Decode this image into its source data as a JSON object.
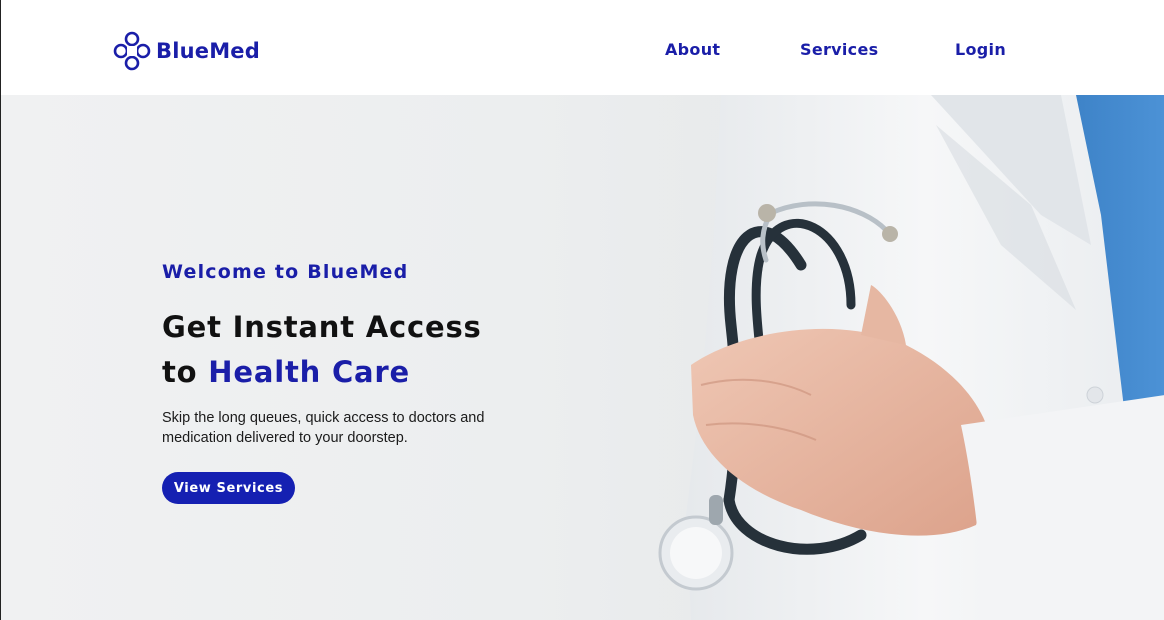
{
  "brand": {
    "name": "BlueMed",
    "color": "#1a1ea8",
    "logo_icon": "medical-cross-rings-icon"
  },
  "nav": {
    "items": [
      {
        "label": "About"
      },
      {
        "label": "Services"
      },
      {
        "label": "Login"
      }
    ]
  },
  "hero": {
    "eyebrow": "Welcome to BlueMed",
    "headline_line1": "Get Instant Access",
    "headline_line2_prefix": "to ",
    "headline_line2_accent": "Health Care",
    "description": "Skip the long queues, quick access to doctors and medication delivered to your doorstep.",
    "cta_label": "View Services",
    "image_subject": "doctor-with-stethoscope",
    "accent_color": "#1a1ea8",
    "button_color": "#1520b2"
  }
}
